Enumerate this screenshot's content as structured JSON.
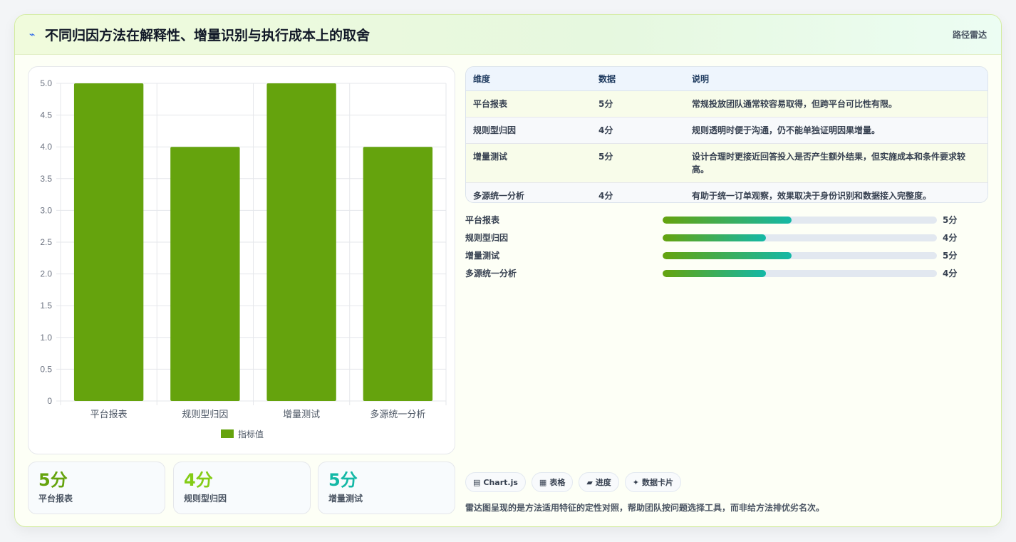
{
  "header": {
    "title_icon": "⌁",
    "title": "不同归因方法在解释性、增量识别与执行成本上的取舍",
    "tag": "路径雷达"
  },
  "chart_data": {
    "type": "bar",
    "categories": [
      "平台报表",
      "规则型归因",
      "增量测试",
      "多源统一分析"
    ],
    "series": [
      {
        "name": "指标值",
        "values": [
          5,
          4,
          5,
          4
        ],
        "color": "#65a30d"
      }
    ],
    "ylim": [
      0,
      5
    ],
    "yticks": [
      "0",
      "0.5",
      "1.0",
      "1.5",
      "2.0",
      "2.5",
      "3.0",
      "3.5",
      "4.0",
      "4.5",
      "5.0"
    ],
    "grid": true,
    "legend": "bottom"
  },
  "kpis": [
    {
      "value": "5分",
      "label": "平台报表",
      "color": "#65a30d"
    },
    {
      "value": "4分",
      "label": "规则型归因",
      "color": "#84cc16"
    },
    {
      "value": "5分",
      "label": "增量测试",
      "color": "#14b8a6"
    }
  ],
  "table": {
    "headers": [
      "维度",
      "数据",
      "说明"
    ],
    "rows": [
      {
        "dim": "平台报表",
        "val": "5分",
        "desc": "常规投放团队通常较容易取得，但跨平台可比性有限。"
      },
      {
        "dim": "规则型归因",
        "val": "4分",
        "desc": "规则透明时便于沟通，仍不能单独证明因果增量。"
      },
      {
        "dim": "增量测试",
        "val": "5分",
        "desc": "设计合理时更接近回答投入是否产生额外结果，但实施成本和条件要求较高。"
      },
      {
        "dim": "多源统一分析",
        "val": "4分",
        "desc": "有助于统一订单观察，效果取决于身份识别和数据接入完整度。"
      }
    ]
  },
  "progress": [
    {
      "label": "平台报表",
      "value": "5分",
      "fraction": 0.47
    },
    {
      "label": "规则型归因",
      "value": "4分",
      "fraction": 0.376
    },
    {
      "label": "增量测试",
      "value": "5分",
      "fraction": 0.47
    },
    {
      "label": "多源统一分析",
      "value": "4分",
      "fraction": 0.376
    }
  ],
  "chips": [
    {
      "icon": "▤",
      "label": "Chart.js"
    },
    {
      "icon": "▦",
      "label": "表格"
    },
    {
      "icon": "▰",
      "label": "进度"
    },
    {
      "icon": "✦",
      "label": "数据卡片"
    }
  ],
  "footnote": "雷达图呈现的是方法适用特征的定性对照，帮助团队按问题选择工具，而非给方法排优劣名次。"
}
